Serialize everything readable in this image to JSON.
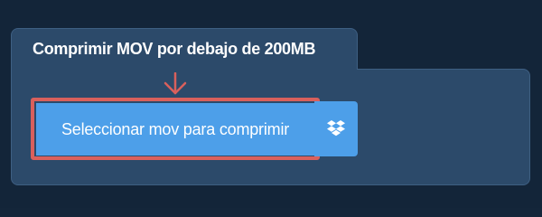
{
  "panel": {
    "title": "Comprimir MOV por debajo de 200MB"
  },
  "actions": {
    "select_label": "Seleccionar mov para comprimir",
    "dropbox_icon": "dropbox-icon"
  },
  "indicator": {
    "arrow_icon": "down-arrow-icon",
    "highlight_color": "#d9605c"
  },
  "colors": {
    "background": "#132539",
    "panel": "#2c4a6a",
    "button": "#4d9fe9",
    "text": "#ffffff"
  }
}
